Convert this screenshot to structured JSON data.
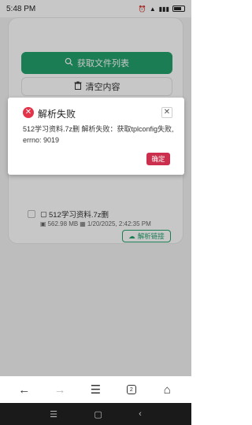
{
  "status_bar": {
    "time": "5:48 PM",
    "icons": [
      "alarm-icon",
      "wifi-icon",
      "signal-icon",
      "battery-icon"
    ],
    "battery_level": 0.6
  },
  "page": {
    "faint_link_text": "",
    "fetch_button_label": "获取文件列表",
    "clear_button_label": "清空内容",
    "file": {
      "name": "512学习资料.7z删",
      "size": "562.98 MB",
      "date": "1/20/2025, 2:42:35 PM",
      "parse_label": "解析链接"
    }
  },
  "dialog": {
    "title": "解析失败",
    "message": "512学习资料.7z删 解析失败：获取tplconfig失败, errno: 9019",
    "ok_label": "确定",
    "close_symbol": "✕"
  },
  "browser_bar": {
    "tab_count": "2"
  },
  "colors": {
    "primary_green": "#23a06b",
    "error_red": "#e3344a",
    "ok_button": "#cc2f4d"
  }
}
